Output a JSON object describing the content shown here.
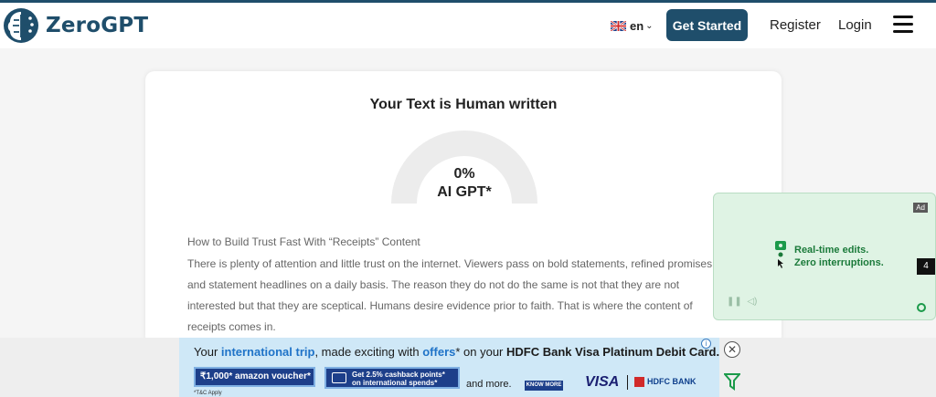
{
  "header": {
    "brand": "ZeroGPT",
    "language": "en",
    "get_started_label": "Get Started",
    "register_label": "Register",
    "login_label": "Login"
  },
  "result": {
    "title": "Your Text is Human written",
    "ai_percentage_value": 0,
    "ai_percentage": "0%",
    "ai_label": "AI GPT*"
  },
  "text": {
    "heading": "How to Build Trust Fast With “Receipts” Content",
    "body": "There is plenty of attention and little trust on the internet. Viewers pass on bold statements, refined promises, and statement headlines on a daily basis. The reason they do not do the same is not that they are not interested but that they are sceptical. Humans desire evidence prior to faith. That is where the content of receipts comes in."
  },
  "side_ad": {
    "badge": "Ad",
    "line1": "Real-time edits.",
    "line2": "Zero interruptions.",
    "counter": "4"
  },
  "banner_ad": {
    "info": "i",
    "seg1": "Your ",
    "seg2": "international trip",
    "seg3": ", made exciting with ",
    "seg4": "offers",
    "seg5": "* on your ",
    "seg6": "HDFC Bank Visa Platinum Debit Card.",
    "voucher": "₹1,000* amazon voucher*",
    "cashback_line1": "Get 2.5% cashback points*",
    "cashback_line2": "on international spends*",
    "and_more": "and more.",
    "know_more": "KNOW MORE",
    "visa": "VISA",
    "hdfc": "HDFC BANK",
    "tnc": "*T&C Apply"
  },
  "icons": {
    "logo": "brain-logo-icon",
    "flag": "uk-flag-icon",
    "menu": "hamburger-menu-icon",
    "close": "close-icon",
    "adchoices": "adchoices-icon"
  },
  "colors": {
    "brand": "#1f4e6b",
    "ad_green": "#1b7a3a",
    "banner_blue": "#cfe8f7"
  }
}
